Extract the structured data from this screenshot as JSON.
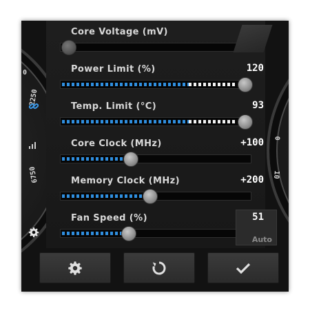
{
  "gauges": {
    "left_ticks": [
      "2250",
      "0",
      "6750"
    ],
    "right_ticks": [
      "0",
      "10"
    ]
  },
  "sliders": [
    {
      "id": "core-voltage",
      "label": "Core Voltage (mV)",
      "value": "",
      "fraction": 0.0,
      "icon": ""
    },
    {
      "id": "power-limit",
      "label": "Power Limit (%)",
      "value": "120",
      "fraction": 1.0,
      "icon": ""
    },
    {
      "id": "temp-limit",
      "label": "Temp. Limit (°C)",
      "value": "93",
      "fraction": 1.0,
      "icon": "link-icon"
    },
    {
      "id": "core-clock",
      "label": "Core Clock (MHz)",
      "value": "+100",
      "fraction": 0.35,
      "icon": "signal-bars-icon"
    },
    {
      "id": "memory-clock",
      "label": "Memory Clock (MHz)",
      "value": "+200",
      "fraction": 0.46,
      "icon": ""
    },
    {
      "id": "fan-speed",
      "label": "Fan Speed (%)",
      "value": "51",
      "fraction": 0.34,
      "icon": "gear-icon"
    }
  ],
  "fan": {
    "auto_label": "Auto"
  },
  "buttons": {
    "settings": "gear-icon",
    "reset": "reset-icon",
    "apply": "checkmark-icon"
  },
  "colors": {
    "accent": "#2f8fe0",
    "link": "#3b97e6"
  }
}
